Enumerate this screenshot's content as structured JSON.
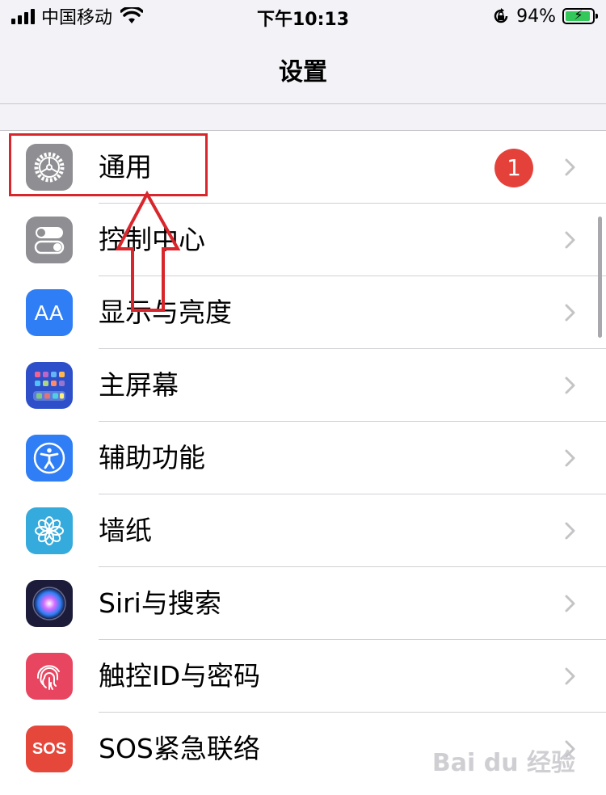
{
  "status_bar": {
    "carrier": "中国移动",
    "time": "下午10:13",
    "battery_percent": "94%",
    "battery_level": 0.94,
    "icons": [
      "signal-icon",
      "wifi-icon",
      "rotation-lock-icon",
      "battery-charging-icon"
    ]
  },
  "nav": {
    "title": "设置"
  },
  "settings": {
    "items": [
      {
        "label": "通用",
        "icon": "gear-icon",
        "icon_bg": "#8e8e93",
        "badge": "1"
      },
      {
        "label": "控制中心",
        "icon": "toggles-icon",
        "icon_bg": "#8e8e93"
      },
      {
        "label": "显示与亮度",
        "icon": "text-size-icon",
        "icon_bg": "#2f7ef5",
        "icon_text": "AA"
      },
      {
        "label": "主屏幕",
        "icon": "home-grid-icon",
        "icon_bg": "#2d4fc9"
      },
      {
        "label": "辅助功能",
        "icon": "accessibility-icon",
        "icon_bg": "#2f7ef5"
      },
      {
        "label": "墙纸",
        "icon": "flower-icon",
        "icon_bg": "#35aadc"
      },
      {
        "label": "Siri与搜索",
        "icon": "siri-icon",
        "icon_bg": "#1c1c3a"
      },
      {
        "label": "触控ID与密码",
        "icon": "fingerprint-icon",
        "icon_bg": "#e84560"
      },
      {
        "label": "SOS紧急联络",
        "icon": "sos-icon",
        "icon_bg": "#e5473b",
        "icon_text": "SOS"
      }
    ]
  },
  "annotation": {
    "color": "#d9262c"
  },
  "watermark": {
    "text": "Bai du 经验"
  }
}
